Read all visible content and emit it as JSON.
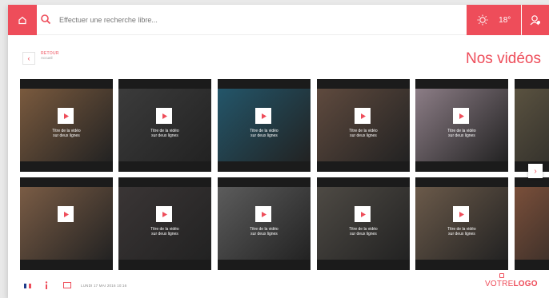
{
  "search": {
    "placeholder": "Effectuer une recherche libre..."
  },
  "weather": {
    "temperature": "18°"
  },
  "nav": {
    "back_label": "RETOUR",
    "back_sub": "Accueil"
  },
  "page": {
    "title": "Nos vidéos"
  },
  "videos": [
    {
      "caption1": "Titre de la vidéo",
      "caption2": "sur deux lignes",
      "tone": "#7a5a3e"
    },
    {
      "caption1": "Titre de la vidéo",
      "caption2": "sur deux lignes",
      "tone": "#3b3b3b"
    },
    {
      "caption1": "Titre de la vidéo",
      "caption2": "sur deux lignes",
      "tone": "#23566a"
    },
    {
      "caption1": "Titre de la vidéo",
      "caption2": "sur deux lignes",
      "tone": "#5f4a3e"
    },
    {
      "caption1": "Titre de la vidéo",
      "caption2": "sur deux lignes",
      "tone": "#8c7d86"
    },
    {
      "caption1": "",
      "caption2": "",
      "tone": "#5a5240"
    },
    {
      "caption1": "",
      "caption2": "",
      "tone": "#7a5c45"
    },
    {
      "caption1": "Titre de la vidéo",
      "caption2": "sur deux lignes",
      "tone": "#3a3535"
    },
    {
      "caption1": "Titre de la vidéo",
      "caption2": "sur deux lignes",
      "tone": "#5c5c5c"
    },
    {
      "caption1": "Titre de la vidéo",
      "caption2": "sur deux lignes",
      "tone": "#4e4a44"
    },
    {
      "caption1": "Titre de la vidéo",
      "caption2": "sur deux lignes",
      "tone": "#6b5a4a"
    },
    {
      "caption1": "",
      "caption2": "",
      "tone": "#7a4f3a"
    }
  ],
  "footer": {
    "date": "LUNDI 17 MAI 2016 10:16"
  },
  "logo": {
    "part1": "VOTRE",
    "part2": "LOGO"
  },
  "colors": {
    "accent": "#ee4d5a"
  }
}
